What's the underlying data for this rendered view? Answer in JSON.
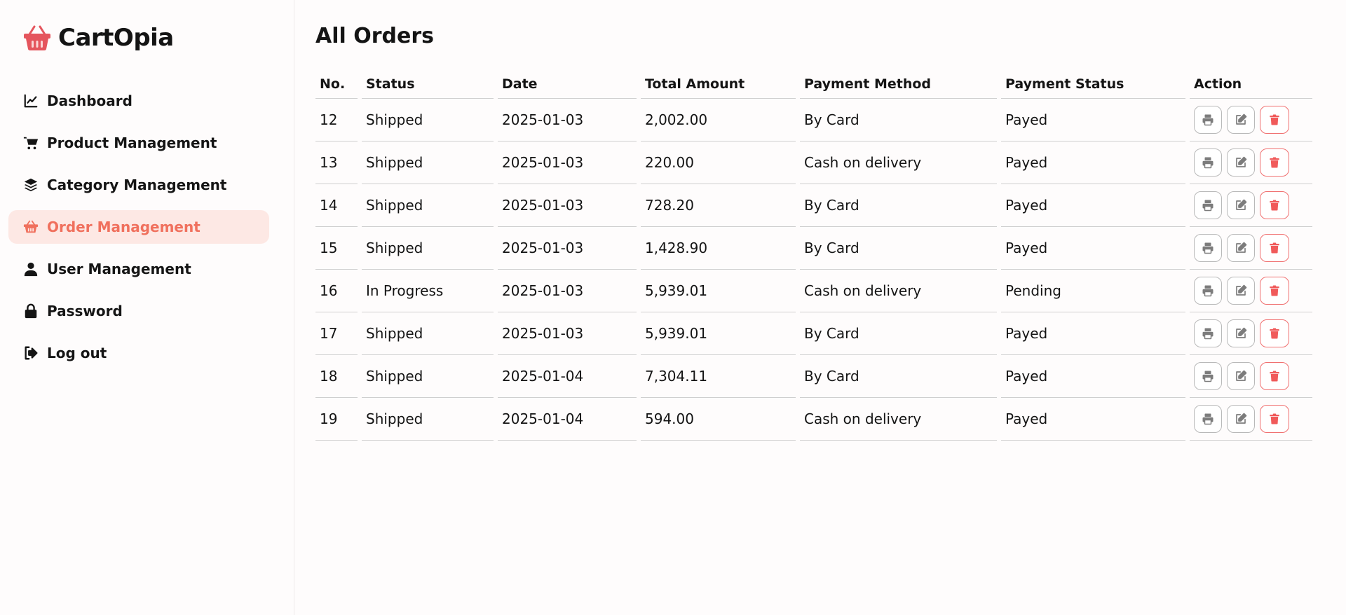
{
  "brand": {
    "name": "CartOpia",
    "logo_icon": "basket-icon",
    "accent": "#e5555d"
  },
  "sidebar": {
    "items": [
      {
        "label": "Dashboard",
        "icon": "chart-line-icon",
        "active": false
      },
      {
        "label": "Product Management",
        "icon": "cart-icon",
        "active": false
      },
      {
        "label": "Category Management",
        "icon": "layers-icon",
        "active": false
      },
      {
        "label": "Order Management",
        "icon": "basket-icon",
        "active": true
      },
      {
        "label": "User Management",
        "icon": "user-icon",
        "active": false
      },
      {
        "label": "Password",
        "icon": "lock-icon",
        "active": false
      },
      {
        "label": "Log out",
        "icon": "logout-icon",
        "active": false
      }
    ],
    "active_color": "#f0705d",
    "active_bg": "#fde8e4"
  },
  "main": {
    "title": "All Orders",
    "table": {
      "headers": [
        "No.",
        "Status",
        "Date",
        "Total Amount",
        "Payment Method",
        "Payment Status",
        "Action"
      ],
      "rows": [
        [
          "12",
          "Shipped",
          "2025-01-03",
          "2,002.00",
          "By Card",
          "Payed"
        ],
        [
          "13",
          "Shipped",
          "2025-01-03",
          "220.00",
          "Cash on delivery",
          "Payed"
        ],
        [
          "14",
          "Shipped",
          "2025-01-03",
          "728.20",
          "By Card",
          "Payed"
        ],
        [
          "15",
          "Shipped",
          "2025-01-03",
          "1,428.90",
          "By Card",
          "Payed"
        ],
        [
          "16",
          "In Progress",
          "2025-01-03",
          "5,939.01",
          "Cash on delivery",
          "Pending"
        ],
        [
          "17",
          "Shipped",
          "2025-01-03",
          "5,939.01",
          "By Card",
          "Payed"
        ],
        [
          "18",
          "Shipped",
          "2025-01-04",
          "7,304.11",
          "By Card",
          "Payed"
        ],
        [
          "19",
          "Shipped",
          "2025-01-04",
          "594.00",
          "Cash on delivery",
          "Payed"
        ]
      ],
      "action_icons": [
        "print-icon",
        "edit-icon",
        "trash-icon"
      ],
      "delete_color": "#f05a5a"
    }
  }
}
